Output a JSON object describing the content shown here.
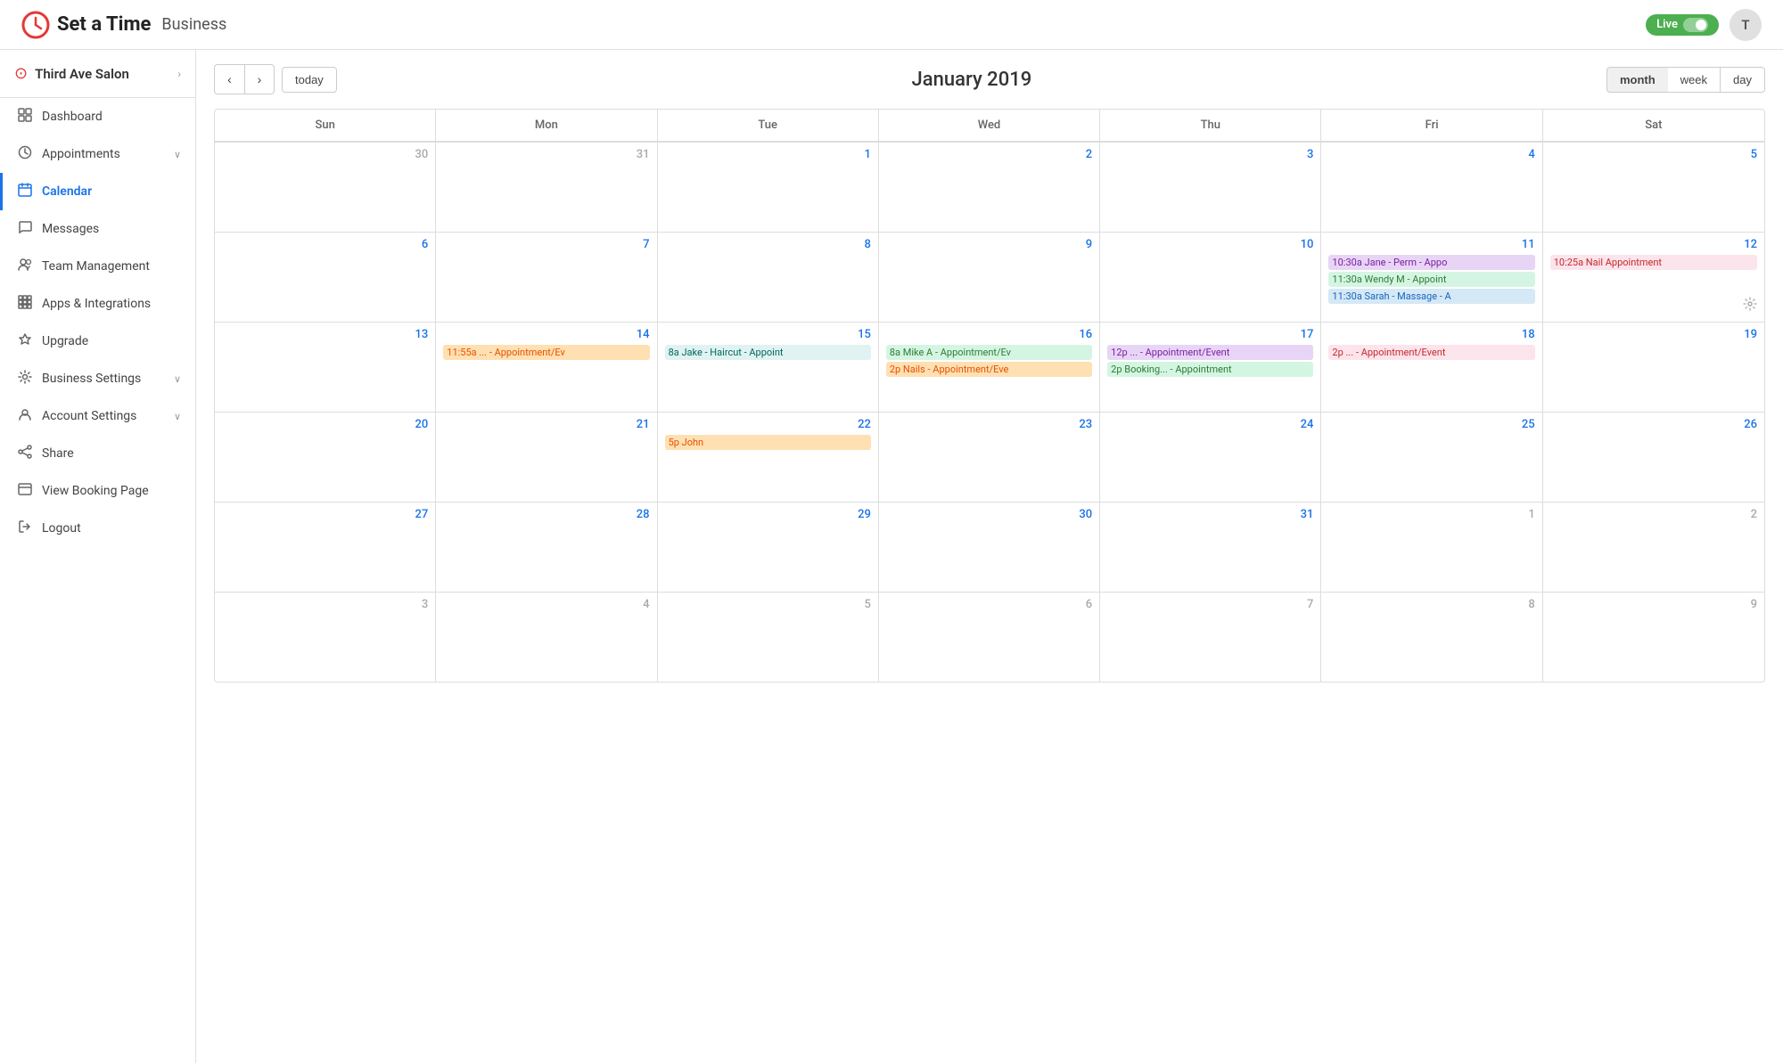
{
  "app": {
    "title": "Set a Time",
    "subtitle": "Business",
    "live_label": "Live",
    "user_initial": "T"
  },
  "sidebar": {
    "salon_name": "Third Ave Salon",
    "items": [
      {
        "id": "dashboard",
        "label": "Dashboard",
        "icon": "⊞",
        "active": false,
        "has_arrow": false
      },
      {
        "id": "appointments",
        "label": "Appointments",
        "icon": "○",
        "active": false,
        "has_arrow": true
      },
      {
        "id": "calendar",
        "label": "Calendar",
        "icon": "▦",
        "active": true,
        "has_arrow": false
      },
      {
        "id": "messages",
        "label": "Messages",
        "icon": "◯",
        "active": false,
        "has_arrow": false
      },
      {
        "id": "team",
        "label": "Team Management",
        "icon": "◎",
        "active": false,
        "has_arrow": false
      },
      {
        "id": "apps",
        "label": "Apps & Integrations",
        "icon": "⊡",
        "active": false,
        "has_arrow": false
      },
      {
        "id": "upgrade",
        "label": "Upgrade",
        "icon": "◇",
        "active": false,
        "has_arrow": false
      },
      {
        "id": "business-settings",
        "label": "Business Settings",
        "icon": "◈",
        "active": false,
        "has_arrow": true
      },
      {
        "id": "account-settings",
        "label": "Account Settings",
        "icon": "◉",
        "active": false,
        "has_arrow": true
      },
      {
        "id": "share",
        "label": "Share",
        "icon": "⟨⟩",
        "active": false,
        "has_arrow": false
      },
      {
        "id": "view-booking",
        "label": "View Booking Page",
        "icon": "□",
        "active": false,
        "has_arrow": false
      },
      {
        "id": "logout",
        "label": "Logout",
        "icon": "→",
        "active": false,
        "has_arrow": false
      }
    ]
  },
  "calendar": {
    "title": "January 2019",
    "today_label": "today",
    "prev_label": "‹",
    "next_label": "›",
    "view_buttons": [
      {
        "id": "month",
        "label": "month",
        "active": true
      },
      {
        "id": "week",
        "label": "week",
        "active": false
      },
      {
        "id": "day",
        "label": "day",
        "active": false
      }
    ],
    "day_headers": [
      "Sun",
      "Mon",
      "Tue",
      "Wed",
      "Thu",
      "Fri",
      "Sat"
    ],
    "weeks": [
      {
        "days": [
          {
            "date": "30",
            "other": true,
            "events": []
          },
          {
            "date": "31",
            "other": true,
            "events": []
          },
          {
            "date": "1",
            "other": false,
            "events": []
          },
          {
            "date": "2",
            "other": false,
            "events": []
          },
          {
            "date": "3",
            "other": false,
            "events": []
          },
          {
            "date": "4",
            "other": false,
            "events": []
          },
          {
            "date": "5",
            "other": false,
            "events": []
          }
        ]
      },
      {
        "days": [
          {
            "date": "6",
            "other": false,
            "events": []
          },
          {
            "date": "7",
            "other": false,
            "events": []
          },
          {
            "date": "8",
            "other": false,
            "events": []
          },
          {
            "date": "9",
            "other": false,
            "events": []
          },
          {
            "date": "10",
            "other": false,
            "events": []
          },
          {
            "date": "11",
            "other": false,
            "events": [
              {
                "time": "10:30a",
                "text": "Jane - Perm - Appo",
                "color": "purple"
              },
              {
                "time": "11:30a",
                "text": "Wendy M - Appoint",
                "color": "green"
              },
              {
                "time": "11:30a",
                "text": "Sarah - Massage - A",
                "color": "blue"
              }
            ]
          },
          {
            "date": "12",
            "other": false,
            "events": [
              {
                "time": "10:25a",
                "text": "Nail Appointment",
                "color": "pink"
              }
            ],
            "has_settings": true
          }
        ]
      },
      {
        "days": [
          {
            "date": "13",
            "other": false,
            "events": []
          },
          {
            "date": "14",
            "other": false,
            "events": [
              {
                "time": "11:55a",
                "text": "... - Appointment/Ev",
                "color": "orange"
              }
            ]
          },
          {
            "date": "15",
            "other": false,
            "events": [
              {
                "time": "8a",
                "text": "Jake - Haircut - Appoint",
                "color": "teal"
              }
            ]
          },
          {
            "date": "16",
            "other": false,
            "events": [
              {
                "time": "8a",
                "text": "Mike A - Appointment/Ev",
                "color": "green"
              },
              {
                "time": "2p",
                "text": "Nails - Appointment/Eve",
                "color": "orange"
              }
            ]
          },
          {
            "date": "17",
            "other": false,
            "events": [
              {
                "time": "12p",
                "text": "... - Appointment/Event",
                "color": "purple"
              },
              {
                "time": "2p",
                "text": "Booking... - Appointment",
                "color": "green"
              }
            ]
          },
          {
            "date": "18",
            "other": false,
            "events": [
              {
                "time": "2p",
                "text": "... - Appointment/Event",
                "color": "pink"
              }
            ]
          },
          {
            "date": "19",
            "other": false,
            "events": []
          }
        ]
      },
      {
        "days": [
          {
            "date": "20",
            "other": false,
            "events": []
          },
          {
            "date": "21",
            "other": false,
            "events": []
          },
          {
            "date": "22",
            "other": false,
            "events": [
              {
                "time": "5p",
                "text": "John",
                "color": "orange"
              }
            ]
          },
          {
            "date": "23",
            "other": false,
            "events": []
          },
          {
            "date": "24",
            "other": false,
            "events": []
          },
          {
            "date": "25",
            "other": false,
            "events": []
          },
          {
            "date": "26",
            "other": false,
            "events": []
          }
        ]
      },
      {
        "days": [
          {
            "date": "27",
            "other": false,
            "events": []
          },
          {
            "date": "28",
            "other": false,
            "events": []
          },
          {
            "date": "29",
            "other": false,
            "events": []
          },
          {
            "date": "30",
            "other": false,
            "events": []
          },
          {
            "date": "31",
            "other": false,
            "events": []
          },
          {
            "date": "1",
            "other": true,
            "events": []
          },
          {
            "date": "2",
            "other": true,
            "events": []
          }
        ]
      },
      {
        "days": [
          {
            "date": "3",
            "other": true,
            "events": []
          },
          {
            "date": "4",
            "other": true,
            "events": []
          },
          {
            "date": "5",
            "other": true,
            "events": []
          },
          {
            "date": "6",
            "other": true,
            "events": []
          },
          {
            "date": "7",
            "other": true,
            "events": []
          },
          {
            "date": "8",
            "other": true,
            "events": []
          },
          {
            "date": "9",
            "other": true,
            "events": []
          }
        ]
      }
    ]
  }
}
